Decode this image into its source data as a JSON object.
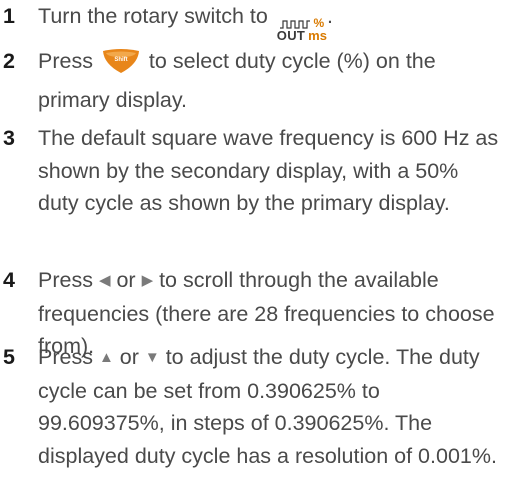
{
  "steps": [
    {
      "number": "1",
      "before": "Turn the rotary switch to ",
      "after": "."
    },
    {
      "number": "2",
      "before": "Press ",
      "after": " to select duty cycle (%) on the primary display."
    },
    {
      "number": "3",
      "text": "The default square wave frequency is 600 Hz as shown by the secondary display, with a 50% duty cycle as shown by the primary display."
    },
    {
      "number": "4",
      "before": "Press ",
      "middle": " or ",
      "after": " to scroll through the available frequencies (there are 28 frequencies to choose from)."
    },
    {
      "number": "5",
      "before": "Press ",
      "middle": " or ",
      "after": " to adjust the duty cycle. The duty cycle can be set from 0.390625% to 99.609375%, in steps of 0.390625%. The displayed duty cycle has a resolution of 0.001%."
    }
  ],
  "icons": {
    "rotary_symbol": {
      "top_right": "%",
      "bottom_left": "OUT",
      "bottom_right": "ms"
    },
    "shift_button": {
      "label": "Shift",
      "color": "#e8861a"
    },
    "left_arrow": "◀",
    "right_arrow": "▶",
    "up_arrow": "▲",
    "down_arrow": "▼"
  }
}
